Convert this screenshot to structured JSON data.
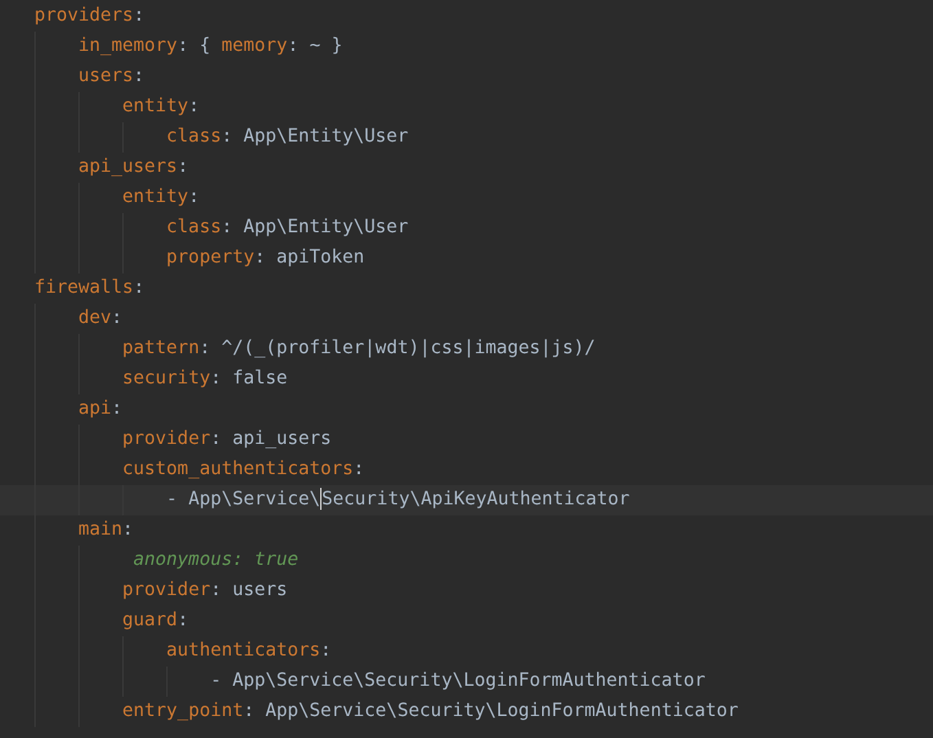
{
  "editor": {
    "lines": [
      {
        "kind": "entry",
        "key": "providers",
        "sep": ":",
        "children": [
          {
            "kind": "flow-map",
            "key": "in_memory",
            "sep": ":",
            "open": "{",
            "entries": [
              {
                "key": "memory",
                "sep": ":",
                "value": "~"
              }
            ],
            "close": "}"
          },
          {
            "kind": "entry",
            "key": "users",
            "sep": ":",
            "children": [
              {
                "kind": "entry",
                "key": "entity",
                "sep": ":",
                "children": [
                  {
                    "kind": "entry",
                    "key": "class",
                    "sep": ":",
                    "value": "App\\Entity\\User"
                  }
                ]
              }
            ]
          },
          {
            "kind": "entry",
            "key": "api_users",
            "sep": ":",
            "children": [
              {
                "kind": "entry",
                "key": "entity",
                "sep": ":",
                "children": [
                  {
                    "kind": "entry",
                    "key": "class",
                    "sep": ":",
                    "value": "App\\Entity\\User"
                  },
                  {
                    "kind": "entry",
                    "key": "property",
                    "sep": ":",
                    "value": "apiToken"
                  }
                ]
              }
            ]
          }
        ]
      },
      {
        "kind": "entry",
        "key": "firewalls",
        "sep": ":",
        "children": [
          {
            "kind": "entry",
            "key": "dev",
            "sep": ":",
            "children": [
              {
                "kind": "entry",
                "key": "pattern",
                "sep": ":",
                "value": "^/(_(profiler|wdt)|css|images|js)/"
              },
              {
                "kind": "entry",
                "key": "security",
                "sep": ":",
                "value": "false"
              }
            ]
          },
          {
            "kind": "entry",
            "key": "api",
            "sep": ":",
            "children": [
              {
                "kind": "entry",
                "key": "provider",
                "sep": ":",
                "value": "api_users"
              },
              {
                "kind": "entry",
                "key": "custom_authenticators",
                "sep": ":",
                "children": [
                  {
                    "kind": "list-item",
                    "dash": "-",
                    "value_before_caret": "App\\Service\\",
                    "value_after_caret": "Security\\ApiKeyAuthenticator"
                  }
                ]
              }
            ]
          },
          {
            "kind": "entry",
            "key": "main",
            "sep": ":",
            "children": [
              {
                "kind": "comment",
                "text": "anonymous: true"
              },
              {
                "kind": "entry",
                "key": "provider",
                "sep": ":",
                "value": "users"
              },
              {
                "kind": "entry",
                "key": "guard",
                "sep": ":",
                "children": [
                  {
                    "kind": "entry",
                    "key": "authenticators",
                    "sep": ":",
                    "children": [
                      {
                        "kind": "list-item",
                        "dash": "-",
                        "value": "App\\Service\\Security\\LoginFormAuthenticator"
                      }
                    ]
                  }
                ]
              },
              {
                "kind": "entry",
                "key": "entry_point",
                "sep": ":",
                "value": "App\\Service\\Security\\LoginFormAuthenticator"
              }
            ]
          }
        ]
      }
    ]
  }
}
